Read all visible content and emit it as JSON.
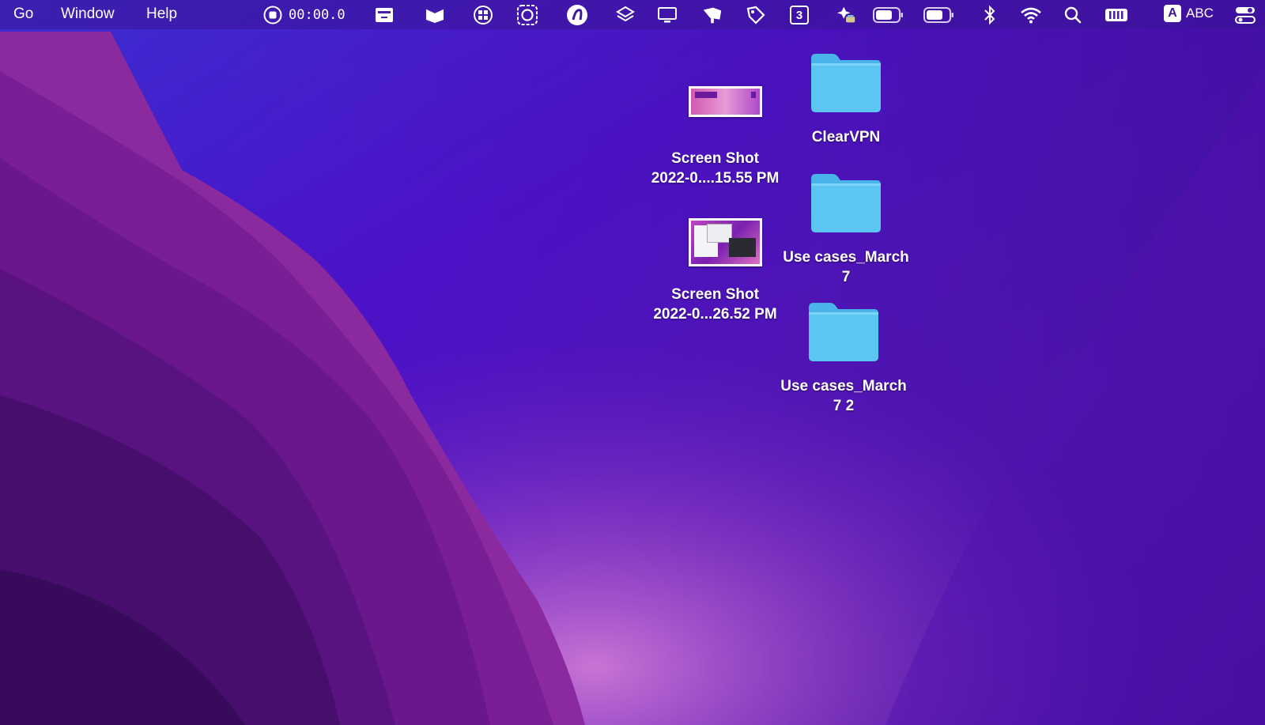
{
  "menubar": {
    "menus": [
      "Go",
      "Window",
      "Help"
    ],
    "recorder_time": "00:00.0",
    "calendar_day": "3",
    "input_source_letter": "A",
    "input_source_label": "ABC"
  },
  "desktop": {
    "files": [
      {
        "line1": "Screen Shot",
        "line2": "2022-0....15.55 PM"
      },
      {
        "line1": "Screen Shot",
        "line2": "2022-0...26.52 PM"
      }
    ],
    "folders": [
      {
        "line1": "ClearVPN",
        "line2": ""
      },
      {
        "line1": "Use cases_March",
        "line2": "7"
      },
      {
        "line1": "Use cases_March",
        "line2": "7 2"
      }
    ]
  },
  "colors": {
    "folder": "#5cc6f3",
    "folder_tab": "#45b0e6",
    "wallpaper_base": "#4a12b8"
  }
}
